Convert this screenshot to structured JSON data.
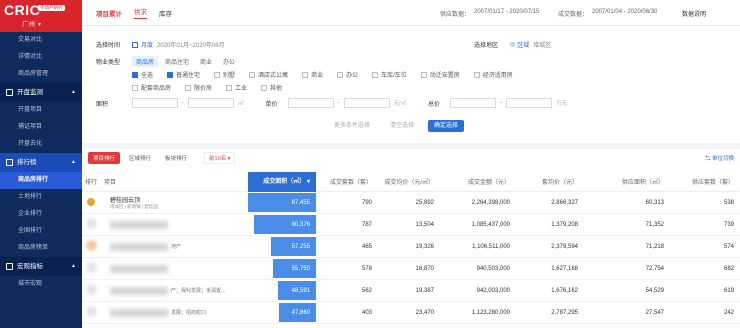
{
  "logo": {
    "text": "CRIC",
    "tag": "不动产研究",
    "city": "广州"
  },
  "sidebar": {
    "items_top": [
      "交易对比",
      "详情对比",
      "商品房管理"
    ],
    "section1": "开盘监测",
    "items_mid": [
      "开盘项目",
      "捕证项目",
      "开盘去化"
    ],
    "section2": "排行榜",
    "items_rank": [
      "商品房排行",
      "土地排行",
      "企业排行",
      "全国排行",
      "商品房榜单"
    ],
    "section3": "宏观指标",
    "items_bottom": [
      "城市宏观"
    ]
  },
  "topbar": {
    "tabs": [
      "项目累计",
      "供求",
      "库存"
    ],
    "supply_label": "供应数据：",
    "supply_range": "2007/01/17 - 2020/07/15",
    "deal_label": "成交数据：",
    "deal_range": "2007/01/04 - 2020/06/30",
    "help": "数据说明"
  },
  "filters": {
    "time_label": "选择时间",
    "time_mode": "月度",
    "time_range": "2020年01月~2020年06月",
    "area_label": "选择地区",
    "area_mode": "区域",
    "area_value": "增城区",
    "type_label": "物业类型",
    "type_tabs": [
      "商品房",
      "商品住宅",
      "商业",
      "办公"
    ],
    "checkboxes_row1": [
      "全选",
      "普通住宅",
      "别墅",
      "酒店式公寓",
      "商业",
      "办公",
      "车库/车位",
      "动迁安置房",
      "经济适用房"
    ],
    "checkboxes_row2": [
      "配套商品房",
      "限价房",
      "工业",
      "其他"
    ],
    "checked": [
      "全选",
      "普通住宅"
    ],
    "area_range_label": "面积",
    "area_unit": "㎡",
    "price_label": "单价",
    "price_unit": "元/㎡",
    "total_label": "总价",
    "total_unit": "万元",
    "btn_more": "更多条件选择",
    "btn_clear": "清空选择",
    "btn_confirm": "确定选择"
  },
  "rank_tabs": [
    "项目排行",
    "区域排行",
    "板块排行"
  ],
  "top_select": "前10名",
  "unit_switch": "单位切换",
  "table": {
    "headers": {
      "rank": "排行",
      "project": "项目",
      "area": "成交面积（㎡）",
      "count": "成交套数（套）",
      "avg_price": "成交均价（元/㎡）",
      "amount": "成交金额（元）",
      "unit_price": "套均价（元）",
      "supply_area": "供应面积（㎡）",
      "supply_count": "供应套数（套）"
    },
    "rows": [
      {
        "project": "碧桂园云顶",
        "sub": "增城区 | 新塘镇 | 碧桂园",
        "tail": "",
        "area": "87,455",
        "count": "790",
        "avg_price": "25,892",
        "amount": "2,264,398,000",
        "unit_price": "2,866,327",
        "supply_area": "60,313",
        "supply_count": "538"
      },
      {
        "project": "",
        "sub": "",
        "tail": "",
        "area": "80,376",
        "count": "787",
        "avg_price": "13,504",
        "amount": "1,085,437,000",
        "unit_price": "1,379,208",
        "supply_area": "71,352",
        "supply_count": "739"
      },
      {
        "project": "",
        "sub": "",
        "tail": "地产",
        "area": "57,255",
        "count": "465",
        "avg_price": "19,326",
        "amount": "1,106,511,000",
        "unit_price": "2,379,594",
        "supply_area": "71,218",
        "supply_count": "574"
      },
      {
        "project": "",
        "sub": "",
        "tail": "",
        "area": "55,750",
        "count": "578",
        "avg_price": "16,870",
        "amount": "940,503,000",
        "unit_price": "1,627,168",
        "supply_area": "72,754",
        "supply_count": "682"
      },
      {
        "project": "",
        "sub": "",
        "tail": "产；保利发展；米润置...",
        "area": "48,591",
        "count": "562",
        "avg_price": "19,387",
        "amount": "942,003,000",
        "unit_price": "1,676,162",
        "supply_area": "54,529",
        "supply_count": "619"
      },
      {
        "project": "",
        "sub": "",
        "tail": "发展；招商蛇口",
        "area": "47,860",
        "count": "403",
        "avg_price": "23,470",
        "amount": "1,123,280,000",
        "unit_price": "2,787,295",
        "supply_area": "27,547",
        "supply_count": "242"
      }
    ],
    "bar_fractions": [
      1.0,
      0.919,
      0.655,
      0.637,
      0.556,
      0.547
    ]
  }
}
